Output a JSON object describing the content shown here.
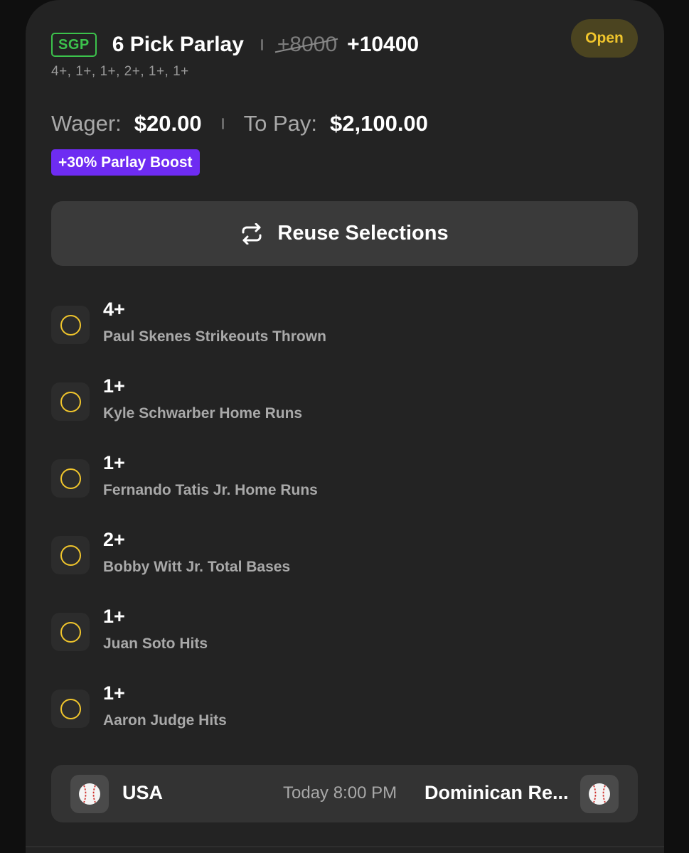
{
  "bet": {
    "type_badge": "SGP",
    "title": "6 Pick Parlay",
    "original_odds": "+8000",
    "boosted_odds": "+10400",
    "status": "Open",
    "legs_summary": "4+, 1+, 1+, 2+, 1+, 1+"
  },
  "wager": {
    "wager_label": "Wager:",
    "wager_value": "$20.00",
    "to_pay_label": "To Pay:",
    "to_pay_value": "$2,100.00"
  },
  "boost": {
    "label": "+30% Parlay Boost"
  },
  "reuse_button": {
    "label": "Reuse Selections",
    "icon": "repeat-icon"
  },
  "legs": [
    {
      "line": "4+",
      "market": "Paul Skenes Strikeouts Thrown",
      "status_icon": "pending-circle-icon"
    },
    {
      "line": "1+",
      "market": "Kyle Schwarber Home Runs",
      "status_icon": "pending-circle-icon"
    },
    {
      "line": "1+",
      "market": "Fernando Tatis Jr. Home Runs",
      "status_icon": "pending-circle-icon"
    },
    {
      "line": "2+",
      "market": "Bobby Witt Jr. Total Bases",
      "status_icon": "pending-circle-icon"
    },
    {
      "line": "1+",
      "market": "Juan Soto Hits",
      "status_icon": "pending-circle-icon"
    },
    {
      "line": "1+",
      "market": "Aaron Judge Hits",
      "status_icon": "pending-circle-icon"
    }
  ],
  "game": {
    "home_team": "USA",
    "time": "Today 8:00 PM",
    "away_team": "Dominican Re...",
    "team_icon": "baseball-icon"
  },
  "colors": {
    "sgp_green": "#3cc24c",
    "status_yellow": "#f0c52c",
    "boost_purple": "#6e2cf2",
    "card_bg": "#232323"
  }
}
